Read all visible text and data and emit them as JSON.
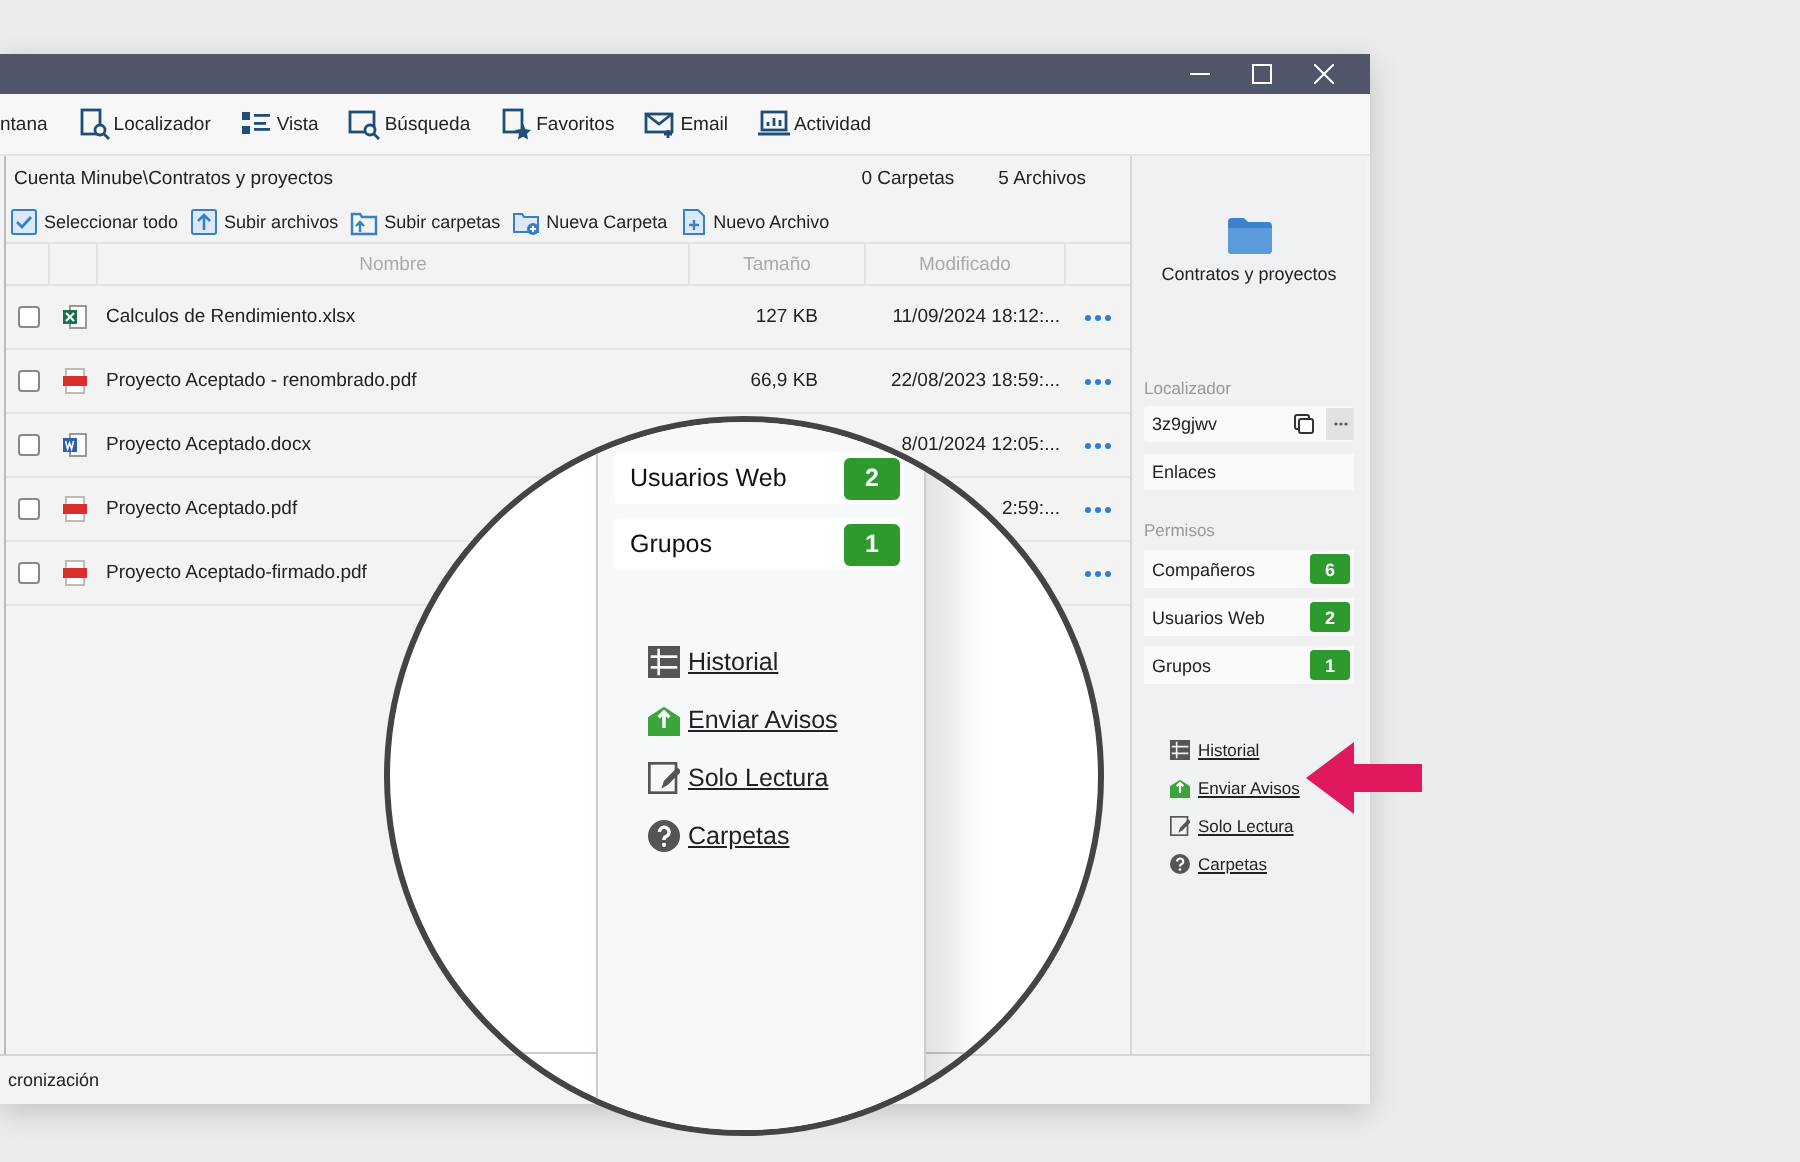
{
  "toolbar": [
    {
      "label": "ntana"
    },
    {
      "label": "Localizador"
    },
    {
      "label": "Vista"
    },
    {
      "label": "Búsqueda"
    },
    {
      "label": "Favoritos"
    },
    {
      "label": "Email"
    },
    {
      "label": "Actividad"
    }
  ],
  "path": "Cuenta Minube\\Contratos y proyectos",
  "folder_count": "0 Carpetas",
  "file_count": "5 Archivos",
  "actions": [
    {
      "label": "Seleccionar todo"
    },
    {
      "label": "Subir archivos"
    },
    {
      "label": "Subir carpetas"
    },
    {
      "label": "Nueva Carpeta"
    },
    {
      "label": "Nuevo Archivo"
    }
  ],
  "columns": [
    "Nombre",
    "Tamaño",
    "Modificado"
  ],
  "rows": [
    {
      "kind": "excel",
      "checked": false,
      "name": "Calculos de Rendimiento.xlsx",
      "size": "127 KB",
      "modified": "11/09/2024 18:12:..."
    },
    {
      "kind": "pdf",
      "checked": false,
      "name": "Proyecto Aceptado - renombrado.pdf",
      "size": "66,9 KB",
      "modified": "22/08/2023 18:59:..."
    },
    {
      "kind": "word",
      "checked": false,
      "name": "Proyecto Aceptado.docx",
      "modified": "8/01/2024 12:05:..."
    },
    {
      "kind": "pdf",
      "checked": false,
      "name": "Proyecto Aceptado.pdf",
      "modified": "2:59:..."
    },
    {
      "kind": "pdf",
      "checked": false,
      "name": "Proyecto Aceptado-firmado.pdf"
    }
  ],
  "details": {
    "folder_name": "Contratos y proyectos",
    "locator_label": "Localizador",
    "locator": "3z9gjwv",
    "links_button": "Enlaces",
    "permissions_label": "Permisos",
    "permissions": [
      {
        "label": "Compañeros",
        "count": "6"
      },
      {
        "label": "Usuarios Web",
        "count": "2"
      },
      {
        "label": "Grupos",
        "count": "1"
      }
    ],
    "links": [
      {
        "kind": "history",
        "label": "Historial"
      },
      {
        "kind": "notify",
        "label": "Enviar Avisos"
      },
      {
        "kind": "readonly",
        "label": "Solo Lectura"
      },
      {
        "kind": "help",
        "label": "Carpetas"
      }
    ]
  },
  "magnifier": {
    "permissions": [
      {
        "label": "Usuarios Web",
        "count": "2"
      },
      {
        "label": "Grupos",
        "count": "1"
      }
    ],
    "links": [
      {
        "kind": "history",
        "label": "Historial"
      },
      {
        "kind": "notify",
        "label": "Enviar Avisos"
      },
      {
        "kind": "readonly",
        "label": "Solo Lectura"
      },
      {
        "kind": "help",
        "label": "Carpetas"
      }
    ]
  },
  "status_bar": "cronización"
}
